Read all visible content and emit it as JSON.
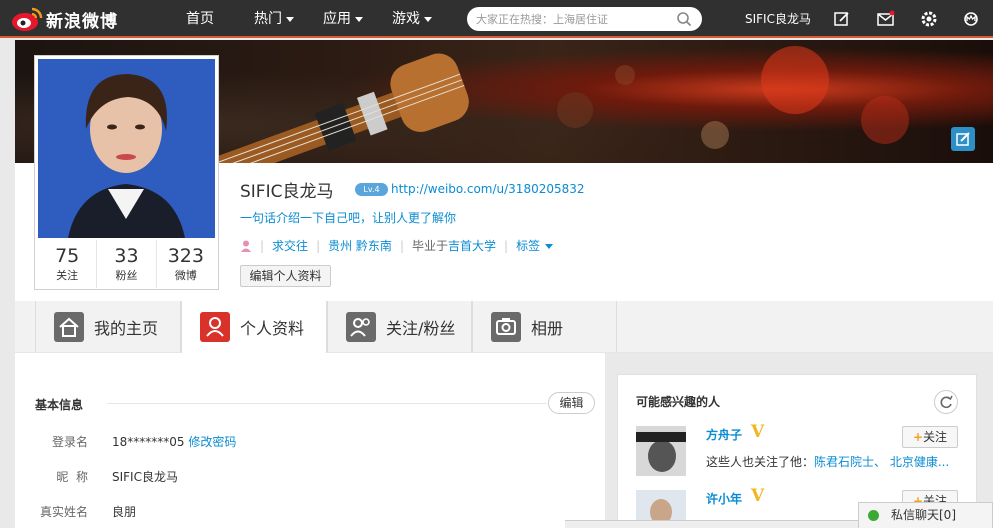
{
  "nav": {
    "logo_text": "新浪微博",
    "items": [
      {
        "label": "首页",
        "dropdown": false
      },
      {
        "label": "热门",
        "dropdown": true
      },
      {
        "label": "应用",
        "dropdown": true
      },
      {
        "label": "游戏",
        "dropdown": true
      }
    ],
    "search_placeholder": "大家正在热搜：上海居住证",
    "user_name": "SIFIC良龙马",
    "icons": [
      "edit-icon",
      "message-icon",
      "settings-icon",
      "crown-icon"
    ],
    "accent_color": "#d55a2f"
  },
  "profile": {
    "name": "SIFIC良龙马",
    "level": "Lv.4",
    "url": "http://weibo.com/u/3180205832",
    "intro": "一句话介绍一下自己吧，让别人更了解你",
    "meta": {
      "status": "求交往",
      "location": "贵州 黔东南",
      "graduated_prefix": "毕业于",
      "school": "吉首大学",
      "tags": "标签"
    },
    "edit_label": "编辑个人资料",
    "stats": [
      {
        "num": "75",
        "label": "关注"
      },
      {
        "num": "33",
        "label": "粉丝"
      },
      {
        "num": "323",
        "label": "微博"
      }
    ]
  },
  "tabs": [
    {
      "label": "我的主页",
      "icon": "home-icon",
      "active": false
    },
    {
      "label": "个人资料",
      "icon": "profile-icon",
      "active": true
    },
    {
      "label": "关注/粉丝",
      "icon": "people-icon",
      "active": false
    },
    {
      "label": "相册",
      "icon": "camera-icon",
      "active": false
    }
  ],
  "basic_info": {
    "title": "基本信息",
    "edit_label": "编辑",
    "rows": [
      {
        "label": "登录名",
        "value": "18*******05",
        "link": "修改密码"
      },
      {
        "label": "昵  称",
        "value": "SIFIC良龙马",
        "link": ""
      },
      {
        "label": "真实姓名",
        "value": "良朋",
        "link": ""
      }
    ]
  },
  "suggestions": {
    "title": "可能感兴趣的人",
    "people": [
      {
        "name": "方舟子",
        "desc_prefix": "这些人也关注了他：",
        "desc_links": "陈君石院士、 北京健康...",
        "follow": "关注"
      },
      {
        "name": "许小年",
        "desc_prefix": "",
        "desc_links": "",
        "follow": "关注"
      }
    ]
  },
  "chat": {
    "label": "私信聊天[0]"
  }
}
